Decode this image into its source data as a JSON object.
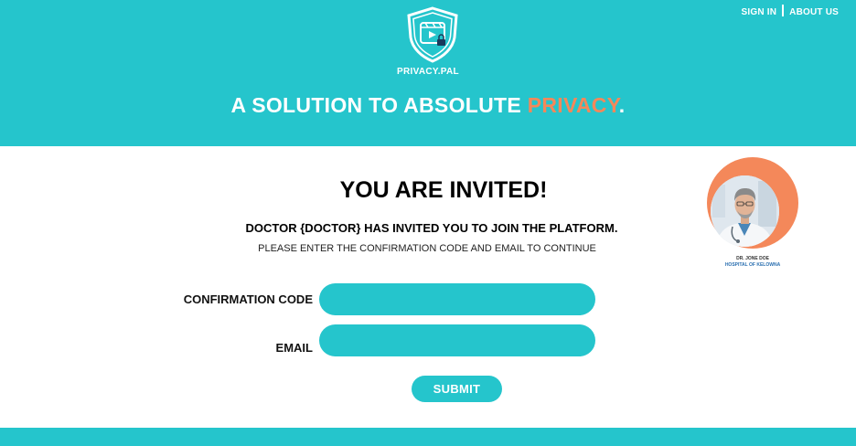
{
  "nav": {
    "sign_in": "SIGN IN",
    "about_us": "ABOUT US"
  },
  "brand": {
    "name": "PRIVACY.PAL",
    "logo_icon": "shield-video-lock-icon"
  },
  "hero": {
    "tagline_prefix": "A SOLUTION TO ABSOLUTE ",
    "tagline_accent": "PRIVACY",
    "tagline_suffix": "."
  },
  "invite": {
    "title": "YOU ARE INVITED!",
    "message": "DOCTOR {DOCTOR} HAS INVITED YOU TO JOIN THE PLATFORM.",
    "instruction": "PLEASE ENTER THE CONFIRMATION CODE AND EMAIL TO CONTINUE"
  },
  "form": {
    "code_label": "CONFIRMATION CODE",
    "code_value": "",
    "email_label": "EMAIL",
    "email_value": "",
    "submit_label": "SUBMIT"
  },
  "doctor": {
    "name": "DR. JONE DOE",
    "hospital": "HOSPITAL OF KELOWNA"
  },
  "colors": {
    "primary": "#25c5cc",
    "accent": "#f4885a",
    "text": "#000000",
    "hospital_link": "#2a6fb0"
  }
}
